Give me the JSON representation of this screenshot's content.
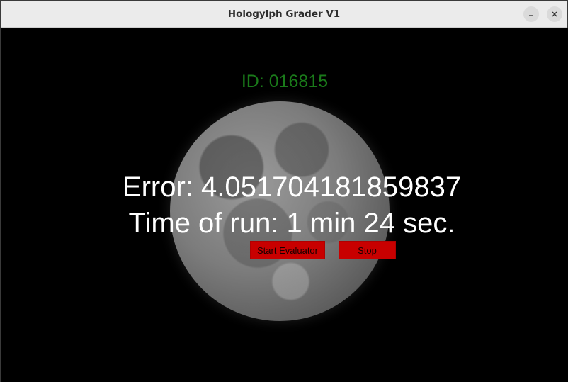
{
  "window": {
    "title": "Hologylph Grader V1"
  },
  "main": {
    "id_label": "ID: 016815",
    "error_text": "Error: 4.051704181859837",
    "time_text": "Time of run: 1 min 24 sec.",
    "start_button_label": "Start Evaluator",
    "stop_button_label": "Stop"
  },
  "colors": {
    "background": "#000000",
    "id_text": "#1a7a1a",
    "primary_text": "#ffffff",
    "button_bg": "#c80000"
  }
}
